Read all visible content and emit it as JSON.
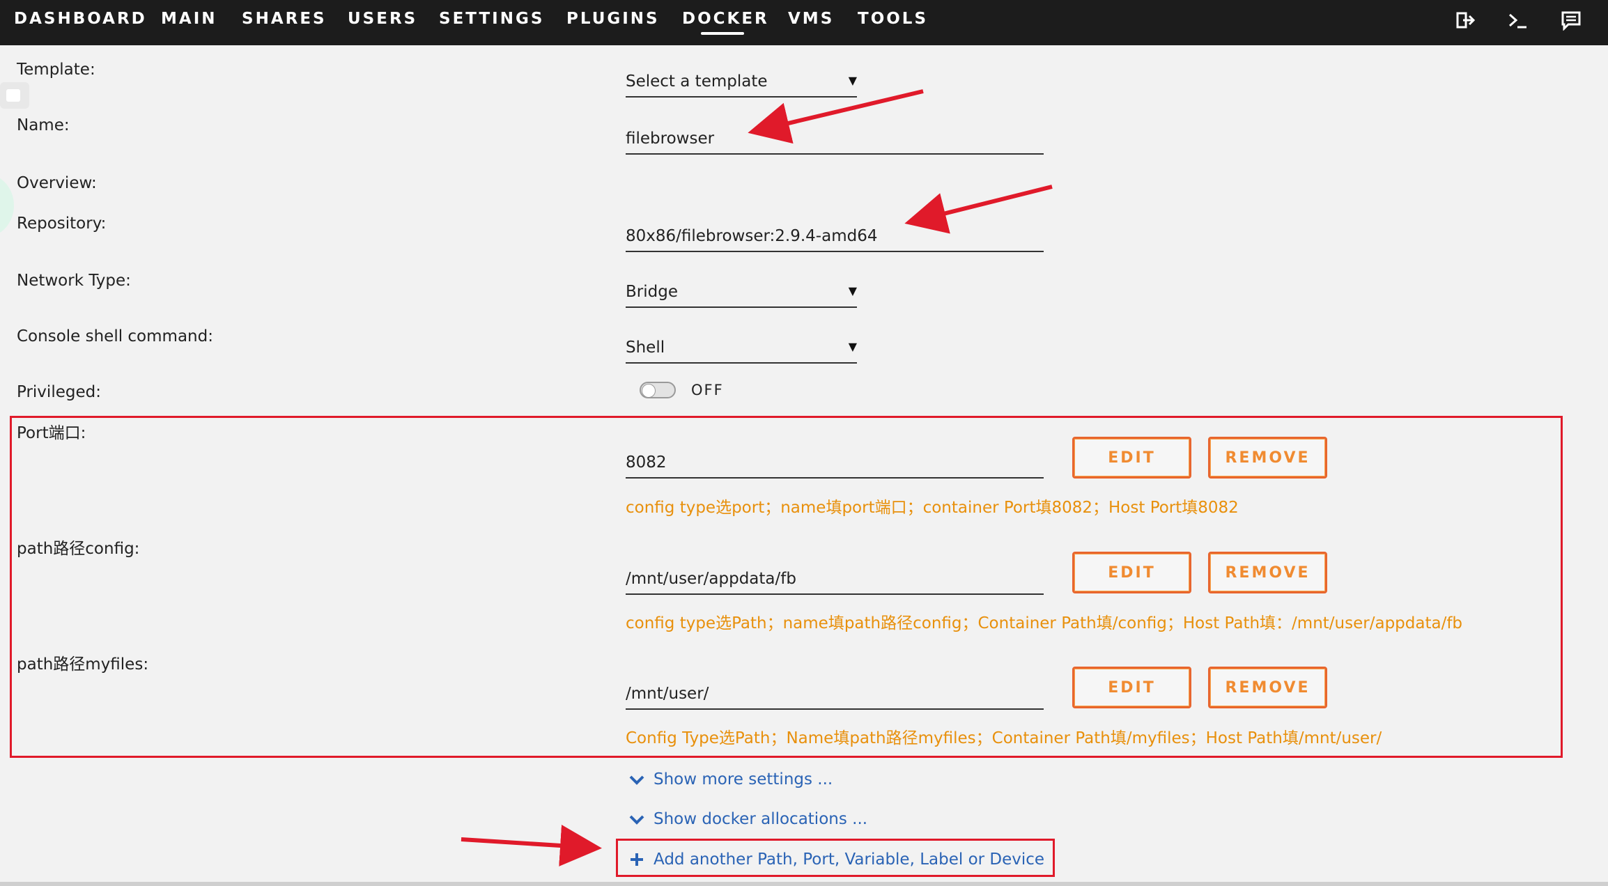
{
  "nav": {
    "items": [
      "DASHBOARD",
      "MAIN",
      "SHARES",
      "USERS",
      "SETTINGS",
      "PLUGINS",
      "DOCKER",
      "VMS",
      "TOOLS"
    ],
    "active": "DOCKER",
    "icons": [
      "logout-icon",
      "terminal-icon",
      "feedback-icon"
    ]
  },
  "form": {
    "template": {
      "label": "Template:",
      "value": "Select a template"
    },
    "name": {
      "label": "Name:",
      "value": "filebrowser"
    },
    "overview": {
      "label": "Overview:"
    },
    "repository": {
      "label": "Repository:",
      "value": "80x86/filebrowser:2.9.4-amd64"
    },
    "network": {
      "label": "Network Type:",
      "value": "Bridge"
    },
    "console": {
      "label": "Console shell command:",
      "value": "Shell"
    },
    "privileged": {
      "label": "Privileged:",
      "state": "OFF"
    }
  },
  "configs": [
    {
      "label": "Port端口:",
      "value": "8082",
      "hint": "config type选port；name填port端口；container Port填8082；Host Port填8082"
    },
    {
      "label": "path路径config:",
      "value": "/mnt/user/appdata/fb",
      "hint": "config type选Path；name填path路径config；Container Path填/config；Host Path填：/mnt/user/appdata/fb"
    },
    {
      "label": "path路径myfiles:",
      "value": "/mnt/user/",
      "hint": "Config Type选Path；Name填path路径myfiles；Container Path填/myfiles；Host Path填/mnt/user/"
    }
  ],
  "buttons": {
    "edit": "EDIT",
    "remove": "REMOVE"
  },
  "links": {
    "more_settings": "Show more settings ...",
    "docker_allocations": "Show docker allocations ...",
    "add_another": "Add another Path, Port, Variable, Label or Device"
  },
  "colors": {
    "nav_bg": "#1c1c1c",
    "page_bg": "#f2f2f2",
    "button_border": "#e8662e",
    "button_text": "#f08b31",
    "hint_text": "#e8900c",
    "link": "#2a63b5",
    "annotation_red": "#e01a2a"
  }
}
